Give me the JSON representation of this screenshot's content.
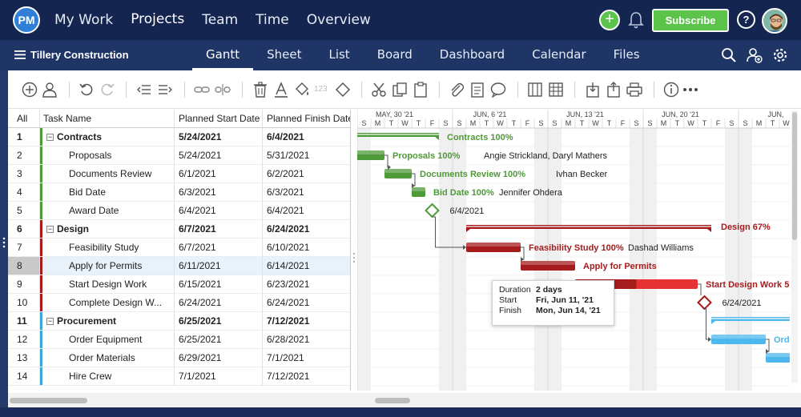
{
  "nav": {
    "logo": "PM",
    "items": [
      {
        "label": "My Work",
        "active": false
      },
      {
        "label": "Projects",
        "active": true
      },
      {
        "label": "Team",
        "active": false
      },
      {
        "label": "Time",
        "active": false
      },
      {
        "label": "Overview",
        "active": false
      }
    ],
    "add_label": "+",
    "subscribe_label": "Subscribe",
    "help_label": "?"
  },
  "project": {
    "title": "Tillery Construction",
    "tabs": [
      {
        "label": "Gantt",
        "active": true
      },
      {
        "label": "Sheet",
        "active": false
      },
      {
        "label": "List",
        "active": false
      },
      {
        "label": "Board",
        "active": false
      },
      {
        "label": "Dashboard",
        "active": false
      },
      {
        "label": "Calendar",
        "active": false
      },
      {
        "label": "Files",
        "active": false
      }
    ]
  },
  "toolbar": {
    "format_123": "123"
  },
  "grid": {
    "headers": {
      "all": "All",
      "name": "Task Name",
      "start": "Planned Start Date",
      "finish": "Planned Finish Date"
    },
    "rows": [
      {
        "num": "1",
        "name": "Contracts",
        "start": "5/24/2021",
        "finish": "6/4/2021",
        "group": true,
        "color": "#4f9a38"
      },
      {
        "num": "2",
        "name": "Proposals",
        "start": "5/24/2021",
        "finish": "5/31/2021",
        "group": false,
        "color": "#4f9a38"
      },
      {
        "num": "3",
        "name": "Documents Review",
        "start": "6/1/2021",
        "finish": "6/2/2021",
        "group": false,
        "color": "#4f9a38"
      },
      {
        "num": "4",
        "name": "Bid Date",
        "start": "6/3/2021",
        "finish": "6/3/2021",
        "group": false,
        "color": "#4f9a38"
      },
      {
        "num": "5",
        "name": "Award Date",
        "start": "6/4/2021",
        "finish": "6/4/2021",
        "group": false,
        "color": "#4f9a38"
      },
      {
        "num": "6",
        "name": "Design",
        "start": "6/7/2021",
        "finish": "6/24/2021",
        "group": true,
        "color": "#a61c1c"
      },
      {
        "num": "7",
        "name": "Feasibility Study",
        "start": "6/7/2021",
        "finish": "6/10/2021",
        "group": false,
        "color": "#a61c1c"
      },
      {
        "num": "8",
        "name": "Apply for Permits",
        "start": "6/11/2021",
        "finish": "6/14/2021",
        "group": false,
        "color": "#a61c1c",
        "selected": true
      },
      {
        "num": "9",
        "name": "Start Design Work",
        "start": "6/15/2021",
        "finish": "6/23/2021",
        "group": false,
        "color": "#a61c1c"
      },
      {
        "num": "10",
        "name": "Complete Design W...",
        "start": "6/24/2021",
        "finish": "6/24/2021",
        "group": false,
        "color": "#a61c1c"
      },
      {
        "num": "11",
        "name": "Procurement",
        "start": "6/25/2021",
        "finish": "7/12/2021",
        "group": true,
        "color": "#3aa7d8"
      },
      {
        "num": "12",
        "name": "Order Equipment",
        "start": "6/25/2021",
        "finish": "6/28/2021",
        "group": false,
        "color": "#3aa7d8"
      },
      {
        "num": "13",
        "name": "Order Materials",
        "start": "6/29/2021",
        "finish": "7/1/2021",
        "group": false,
        "color": "#3aa7d8"
      },
      {
        "num": "14",
        "name": "Hire Crew",
        "start": "7/1/2021",
        "finish": "7/12/2021",
        "group": false,
        "color": "#3aa7d8"
      }
    ]
  },
  "gantt": {
    "weeks": [
      "MAY, 30 '21",
      "JUN, 6 '21",
      "JUN, 13 '21",
      "JUN, 20 '21",
      "JUN,"
    ],
    "day_letters": [
      "S",
      "M",
      "T",
      "W",
      "T",
      "F",
      "S"
    ],
    "labels": {
      "contracts": "Contracts",
      "contracts_pct": "100%",
      "proposals": "Proposals",
      "proposals_pct": "100%",
      "proposals_res": "Angie Strickland, Daryl Mathers",
      "docs": "Documents Review",
      "docs_pct": "100%",
      "docs_res": "Ivhan Becker",
      "bid": "Bid Date",
      "bid_pct": "100%",
      "bid_res": "Jennifer Ohdera",
      "award_date": "6/4/2021",
      "design": "Design",
      "design_pct": "67%",
      "feas": "Feasibility Study",
      "feas_pct": "100%",
      "feas_res": "Dashad Williams",
      "permits": "Apply for Permits",
      "sdw": "Start Design Work",
      "sdw_tail": "5",
      "cdw_date": "6/24/2021",
      "orde": "Ord"
    },
    "colors": {
      "green": "#4f9a38",
      "red": "#a61c1c",
      "red_light": "#e63232",
      "blue": "#4cb8ee"
    }
  },
  "tooltip": {
    "duration_label": "Duration",
    "duration": "2 days",
    "start_label": "Start",
    "start": "Fri, Jun 11, '21",
    "finish_label": "Finish",
    "finish": "Mon, Jun 14, '21"
  }
}
